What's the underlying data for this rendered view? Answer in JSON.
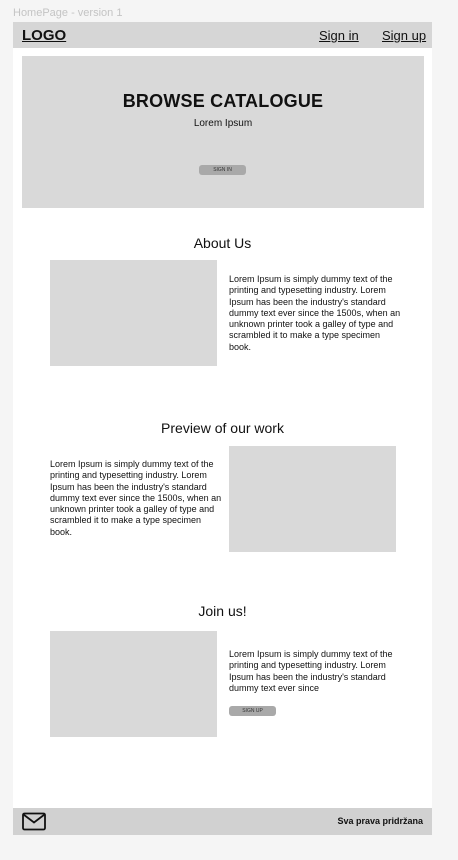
{
  "frame_label": "HomePage - version 1",
  "navbar": {
    "logo": "LOGO",
    "sign_in": "Sign in",
    "sign_up": "Sign up"
  },
  "hero": {
    "title": "BROWSE CATALOGUE",
    "subtitle": "Lorem Ipsum",
    "button_label": "SIGN IN"
  },
  "about": {
    "title": "About Us",
    "text": "Lorem Ipsum is simply dummy text of the printing and typesetting industry. Lorem Ipsum has been the industry's standard dummy text ever since the 1500s, when an unknown printer took a galley of type and scrambled it to make a type specimen book."
  },
  "preview": {
    "title": "Preview of our work",
    "text": "Lorem Ipsum is simply dummy text of the printing and typesetting industry. Lorem Ipsum has been the industry's standard dummy text ever since the 1500s, when an unknown printer took a galley of type and scrambled it to make a type specimen book."
  },
  "join": {
    "title": "Join us!",
    "text": "Lorem Ipsum is simply dummy text of the printing and typesetting industry. Lorem Ipsum has been the industry's standard dummy text ever since",
    "button_label": "SIGN UP"
  },
  "footer": {
    "icon": "mail-icon",
    "rights": "Sva prava pridržana"
  },
  "colors": {
    "page_background": "#f5f5f5",
    "navbar": "#d6d6d6",
    "placeholder": "#d9d9d9",
    "button": "#a9a9a9",
    "footer": "#d1d1d1"
  }
}
